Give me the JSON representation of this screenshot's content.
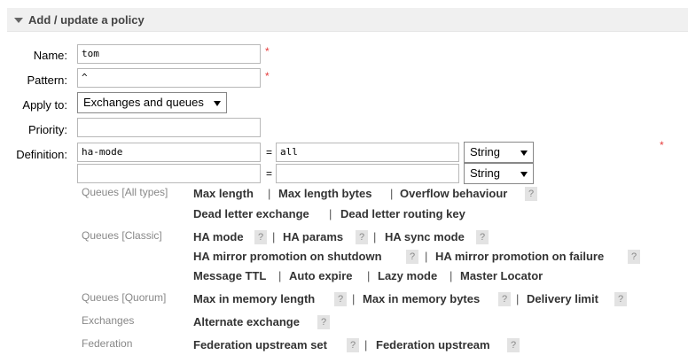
{
  "section": {
    "title": "Add / update a policy"
  },
  "form": {
    "name_label": "Name:",
    "name_value": "tom",
    "pattern_label": "Pattern:",
    "pattern_value": "^",
    "apply_label": "Apply to:",
    "apply_value": "Exchanges and queues",
    "priority_label": "Priority:",
    "priority_value": "",
    "definition_label": "Definition:",
    "required_mark": "*",
    "definitions": [
      {
        "key": "ha-mode",
        "eq": "=",
        "value": "all",
        "type": "String"
      },
      {
        "key": "",
        "eq": "=",
        "value": "",
        "type": "String"
      }
    ]
  },
  "help": {
    "qmark": "?",
    "sep": "|",
    "groups": {
      "queues_all": {
        "label": "Queues [All types]",
        "items": [
          "Max length",
          "Max length bytes",
          "Overflow behaviour",
          "Dead letter exchange",
          "Dead letter routing key"
        ]
      },
      "queues_classic": {
        "label": "Queues [Classic]",
        "items": [
          "HA mode",
          "HA params",
          "HA sync mode",
          "HA mirror promotion on shutdown",
          "HA mirror promotion on failure",
          "Message TTL",
          "Auto expire",
          "Lazy mode",
          "Master Locator"
        ]
      },
      "queues_quorum": {
        "label": "Queues [Quorum]",
        "items": [
          "Max in memory length",
          "Max in memory bytes",
          "Delivery limit"
        ]
      },
      "exchanges": {
        "label": "Exchanges",
        "items": [
          "Alternate exchange"
        ]
      },
      "federation": {
        "label": "Federation",
        "items": [
          "Federation upstream set",
          "Federation upstream"
        ]
      }
    }
  }
}
